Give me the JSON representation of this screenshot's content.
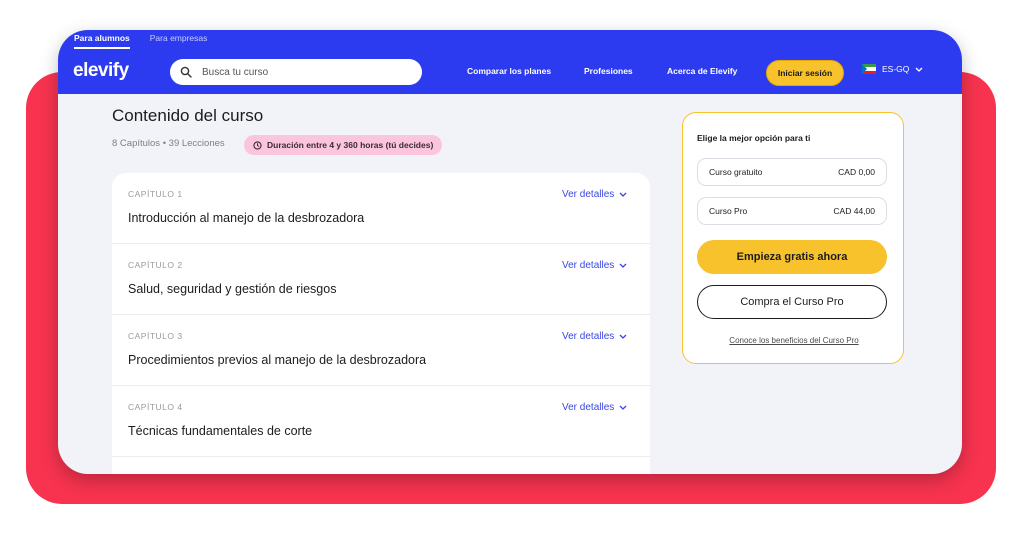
{
  "header": {
    "audience_tabs": [
      "Para alumnos",
      "Para empresas"
    ],
    "logo": "elevify",
    "search_placeholder": "Busca tu curso",
    "nav": [
      "Comparar los planes",
      "Profesiones",
      "Acerca de Elevify"
    ],
    "login_label": "Iniciar sesión",
    "language": "ES-GQ"
  },
  "main": {
    "title": "Contenido del curso",
    "meta": "8 Capítulos • 39 Lecciones",
    "duration": "Duración entre 4 y 360 horas (tú decides)",
    "chapters": [
      {
        "label": "CAPÍTULO 1",
        "title": "Introducción al manejo de la desbrozadora",
        "link": "Ver detalles"
      },
      {
        "label": "CAPÍTULO 2",
        "title": "Salud, seguridad y gestión de riesgos",
        "link": "Ver detalles"
      },
      {
        "label": "CAPÍTULO 3",
        "title": "Procedimientos previos al manejo de la desbrozadora",
        "link": "Ver detalles"
      },
      {
        "label": "CAPÍTULO 4",
        "title": "Técnicas fundamentales de corte",
        "link": "Ver detalles"
      }
    ]
  },
  "plan_card": {
    "title": "Elige la mejor opción para ti",
    "options": [
      {
        "name": "Curso gratuito",
        "price": "CAD 0,00"
      },
      {
        "name": "Curso Pro",
        "price": "CAD 44,00"
      }
    ],
    "primary_cta": "Empieza gratis ahora",
    "secondary_cta": "Compra el Curso Pro",
    "benefits_link": "Conoce los beneficios del Curso Pro"
  },
  "colors": {
    "header_blue": "#2c3bf0",
    "accent_yellow": "#f8c22c",
    "backdrop_red": "#f7334f",
    "badge_pink": "#fbc5de",
    "link_blue": "#3a46e4"
  }
}
